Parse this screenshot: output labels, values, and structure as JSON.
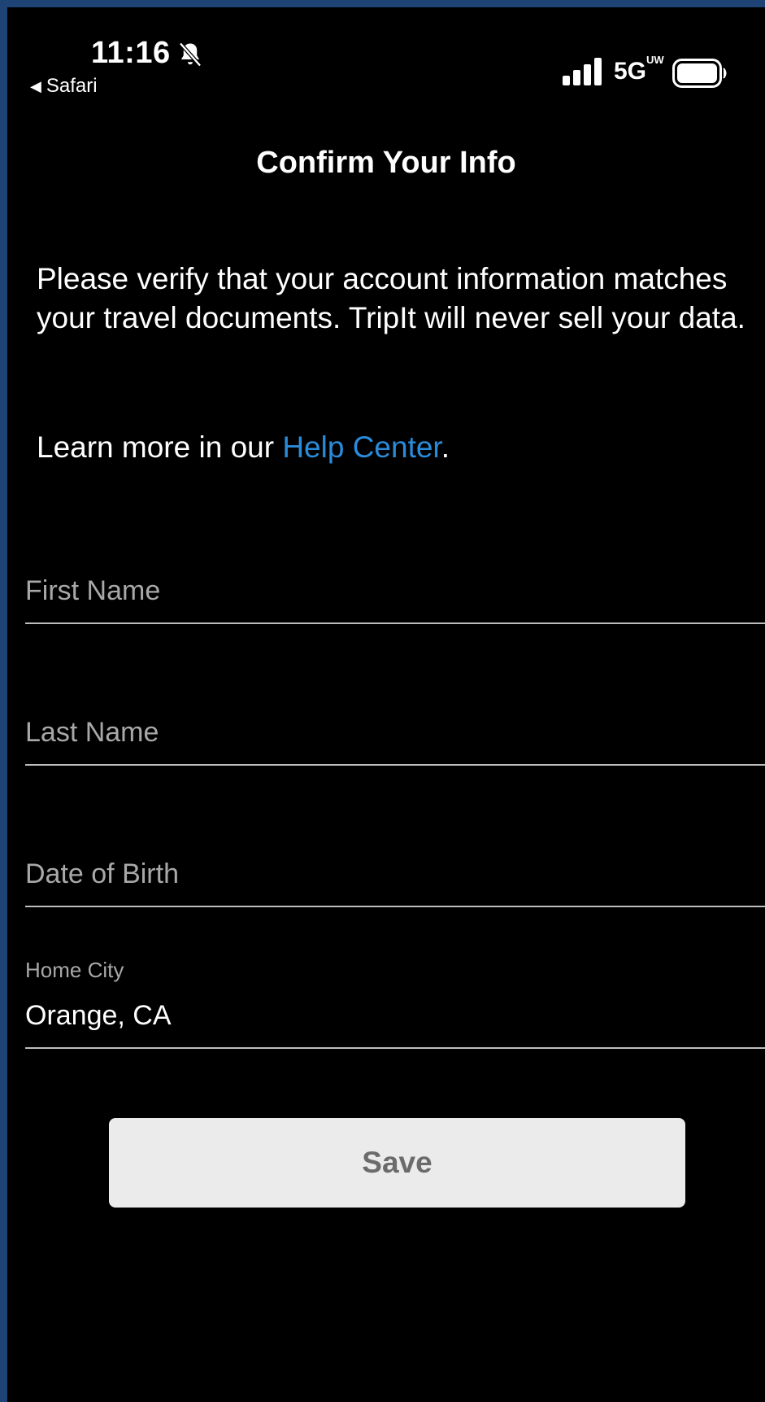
{
  "status_bar": {
    "time": "11:16",
    "back_app": "Safari",
    "network": "5G",
    "network_sup": "UW"
  },
  "page": {
    "title": "Confirm Your Info",
    "description": "Please verify that your account information matches your travel documents. TripIt will never sell your data.",
    "learn_prefix": "Learn more in our ",
    "learn_link": "Help Center",
    "learn_suffix": "."
  },
  "form": {
    "first_name": {
      "placeholder": "First Name",
      "value": ""
    },
    "last_name": {
      "placeholder": "Last Name",
      "value": ""
    },
    "date_of_birth": {
      "placeholder": "Date of Birth",
      "value": ""
    },
    "home_city": {
      "label": "Home City",
      "value": "Orange, CA"
    },
    "save_label": "Save"
  },
  "colors": {
    "link": "#2b8bd9",
    "background": "#000000",
    "frame": "#1d4474",
    "button_bg": "#ebebeb"
  },
  "icons": [
    "bell-slash-icon",
    "back-triangle-icon",
    "cellular-signal-icon",
    "battery-icon"
  ]
}
